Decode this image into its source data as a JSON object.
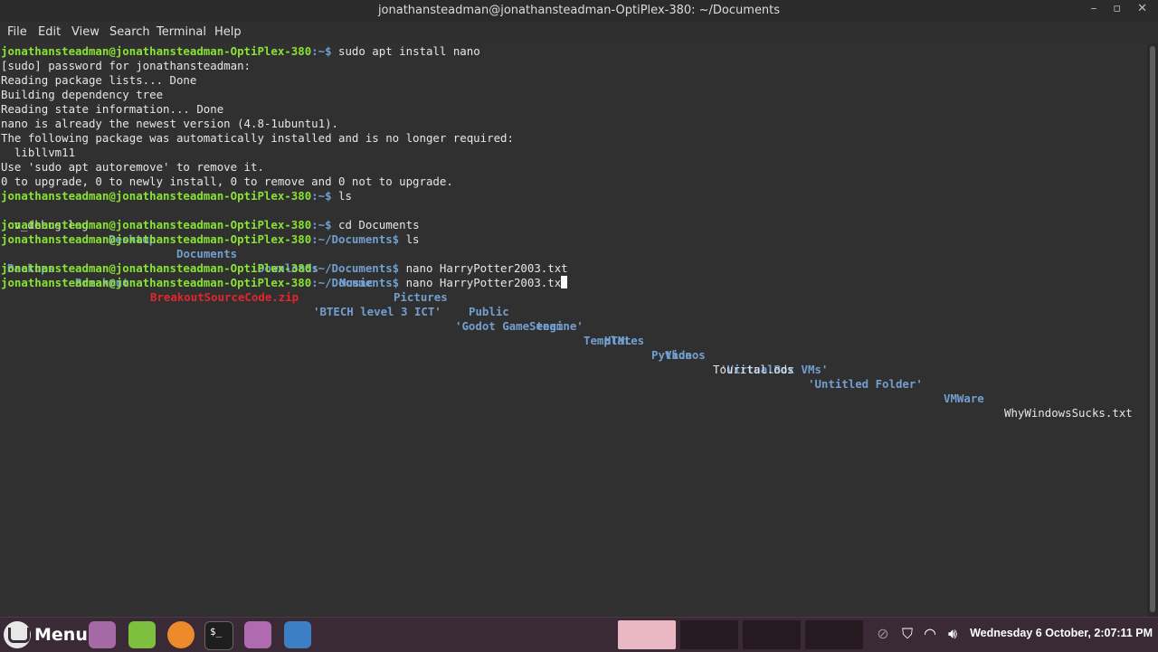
{
  "window": {
    "title": "jonathansteadman@jonathansteadman-OptiPlex-380: ~/Documents",
    "controls": {
      "minimize": "–",
      "maximize": "▫",
      "close": "✕"
    }
  },
  "menu": {
    "items": [
      "File",
      "Edit",
      "View",
      "Search",
      "Terminal",
      "Help"
    ]
  },
  "terminal": {
    "prompt_user": "jonathansteadman@jonathansteadman-OptiPlex-380",
    "lines": {
      "l0_path": ":~$",
      "l0_cmd": " sudo apt install nano",
      "l1": "[sudo] password for jonathansteadman:",
      "l2": "Reading package lists... Done",
      "l3": "Building dependency tree",
      "l4": "Reading state information... Done",
      "l5": "nano is already the newest version (4.8-1ubuntu1).",
      "l6": "The following package was automatically installed and is no longer required:",
      "l7": "  libllvm11",
      "l8": "Use 'sudo apt autoremove' to remove it.",
      "l9": "0 to upgrade, 0 to newly install, 0 to remove and 0 not to upgrade.",
      "l10_path": ":~$",
      "l10_cmd": " ls",
      "l12_path": ":~$",
      "l12_cmd": " cd Documents",
      "l13_path": ":~/Documents$",
      "l13_cmd": " ls",
      "l15_path": ":~/Documents$",
      "l15_cmd": " nano HarryPotter2003.txt",
      "l16_path": ":~/Documents$",
      "l16_cmd": " nano HarryPotter2003.tx"
    },
    "home_listing": [
      {
        "name": "cv_debug.log",
        "kind": "file"
      },
      {
        "name": "Desktop",
        "kind": "dir"
      },
      {
        "name": "Documents",
        "kind": "dir"
      },
      {
        "name": "Downloads",
        "kind": "dir"
      },
      {
        "name": "Music",
        "kind": "dir"
      },
      {
        "name": "Pictures",
        "kind": "dir"
      },
      {
        "name": "Public",
        "kind": "dir"
      },
      {
        "name": "Steam",
        "kind": "dir"
      },
      {
        "name": "Templates",
        "kind": "dir"
      },
      {
        "name": "Videos",
        "kind": "dir"
      },
      {
        "name": "'VirtualBox VMs'",
        "kind": "dir"
      }
    ],
    "documents_listing": [
      {
        "name": "Backups",
        "kind": "dir"
      },
      {
        "name": "Breakout",
        "kind": "dir"
      },
      {
        "name": "BreakoutSourceCode.zip",
        "kind": "archive"
      },
      {
        "name": "'BTECH level 3 ICT'",
        "kind": "dir"
      },
      {
        "name": "'Godot Game engine'",
        "kind": "dir"
      },
      {
        "name": "HTML",
        "kind": "dir"
      },
      {
        "name": "Python",
        "kind": "dir"
      },
      {
        "name": "Tourital.ods",
        "kind": "file"
      },
      {
        "name": "'Untitled Folder'",
        "kind": "dir"
      },
      {
        "name": "VMWare",
        "kind": "dir"
      },
      {
        "name": "WhyWindowsSucks.txt",
        "kind": "file"
      }
    ]
  },
  "taskbar": {
    "menu_label": "Menu",
    "launchers": [
      "show-desktop-icon",
      "mint-update-icon",
      "firefox-icon",
      "terminal-icon",
      "files-icon",
      "screenshot-icon"
    ],
    "tray": [
      "blocked-icon",
      "shield-icon",
      "wifi-icon",
      "volume-icon"
    ],
    "clock": "Wednesday 6 October, 2:07:11 PM"
  },
  "colors": {
    "prompt_user": "#8ae234",
    "prompt_path": "#729fcf",
    "directory": "#729fcf",
    "archive": "#e3262b",
    "panel_bg": "#3a2a35"
  }
}
